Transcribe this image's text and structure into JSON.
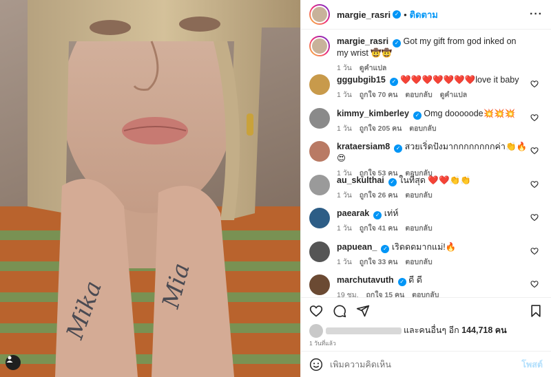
{
  "post": {
    "author": "margie_rasri",
    "follow_label": "ติดตาม",
    "dot": "•",
    "caption": "Got my gift from god inked on my wrist 🤠🤠",
    "caption_time": "1 วัน",
    "translate_label": "ดูคำแปล"
  },
  "comments": [
    {
      "user": "gggubgib15",
      "verified": true,
      "text": "❤️❤️❤️❤️❤️❤️❤️love it baby",
      "time": "1 วัน",
      "likes": "ถูกใจ 70 คน",
      "reply": "ตอบกลับ",
      "translate": "ดูคำแปล",
      "avatar_color": "#c89a4b"
    },
    {
      "user": "kimmy_kimberley",
      "verified": true,
      "text": "Omg dooooode💥💥💥",
      "time": "1 วัน",
      "likes": "ถูกใจ 205 คน",
      "reply": "ตอบกลับ",
      "translate": "",
      "avatar_color": "#8a8a8a"
    },
    {
      "user": "krataersiam8",
      "verified": true,
      "text": "สวยเริ่ดปังมากกกกกกกกค่า👏🔥😍",
      "time": "1 วัน",
      "likes": "ถูกใจ 53 คน",
      "reply": "ตอบกลับ",
      "translate": "",
      "avatar_color": "#b97a64"
    },
    {
      "user": "au_skulthai",
      "verified": true,
      "text": "ในที่สุด ❤️❤️👏👏",
      "time": "1 วัน",
      "likes": "ถูกใจ 26 คน",
      "reply": "ตอบกลับ",
      "translate": "",
      "avatar_color": "#9a9a9a"
    },
    {
      "user": "paearak",
      "verified": true,
      "text": "เท่ห์",
      "time": "1 วัน",
      "likes": "ถูกใจ 41 คน",
      "reply": "ตอบกลับ",
      "translate": "",
      "avatar_color": "#2d5d86"
    },
    {
      "user": "papuean_",
      "verified": true,
      "text": "เริดดดมากแม่!🔥",
      "time": "1 วัน",
      "likes": "ถูกใจ 33 คน",
      "reply": "ตอบกลับ",
      "translate": "",
      "avatar_color": "#555555"
    },
    {
      "user": "marchutavuth",
      "verified": true,
      "text": "ดี ดี",
      "time": "19 ชม.",
      "likes": "ถูกใจ 15 คน",
      "reply": "ตอบกลับ",
      "translate": "",
      "avatar_color": "#6b4a33"
    }
  ],
  "likes_summary": {
    "others_label": "และคนอื่นๆ อีก",
    "count": "144,718 คน"
  },
  "posted_ago": "1 วันที่แล้ว",
  "comment_input": {
    "placeholder": "เพิ่มความคิดเห็น",
    "post_label": "โพสต์"
  },
  "photo": {
    "tattoo_left": "Mika",
    "tattoo_right": "Mia"
  },
  "colors": {
    "accent": "#0095f6",
    "heart": "#ed4956"
  }
}
